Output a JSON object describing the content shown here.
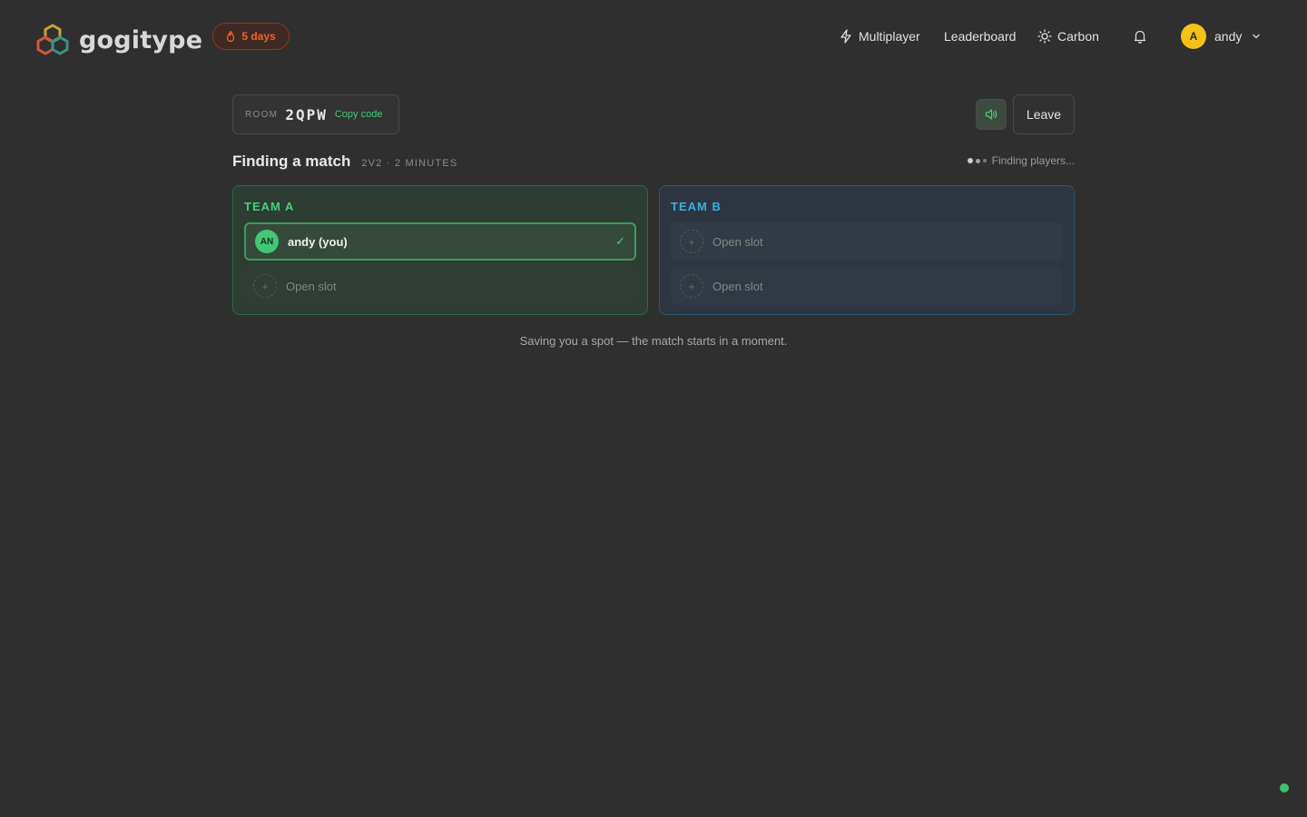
{
  "app": {
    "name": "gogitype",
    "streak": "5 days"
  },
  "nav": {
    "multiplayer": "Multiplayer",
    "leaderboard": "Leaderboard",
    "theme": "Carbon"
  },
  "user": {
    "initial": "A",
    "name": "andy"
  },
  "room": {
    "label": "ROOM",
    "code": "2QPW",
    "copy": "Copy code"
  },
  "actions": {
    "leave": "Leave"
  },
  "match": {
    "title": "Finding a match",
    "subtitle": "2V2 · 2 MINUTES",
    "status": "Finding players..."
  },
  "teams": {
    "a": {
      "title": "TEAM A",
      "player": {
        "initials": "AN",
        "name": "andy (you)",
        "check": "✓"
      },
      "open_slot": "Open slot"
    },
    "b": {
      "title": "TEAM B",
      "open_slot_1": "Open slot",
      "open_slot_2": "Open slot"
    }
  },
  "footer": "Saving you a spot — the match starts in a moment.",
  "colors": {
    "accent_green": "#46cf7a",
    "accent_blue": "#3aaee4",
    "streak_orange": "#f0642c",
    "avatar_yellow": "#f4c216",
    "background": "#2f2f2f"
  },
  "icons": [
    "logo-icon",
    "flame-icon",
    "lightning-icon",
    "sun-icon",
    "bell-icon",
    "chevron-down-icon",
    "speaker-icon",
    "plus-icon",
    "check-icon",
    "loading-dots-icon",
    "status-dot-icon"
  ]
}
